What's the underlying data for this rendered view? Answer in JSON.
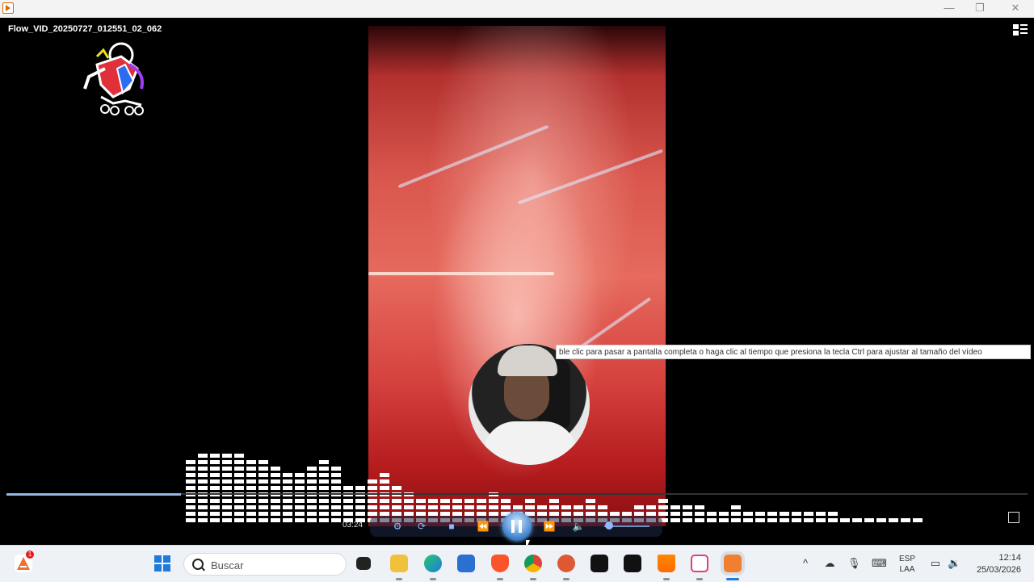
{
  "window": {
    "minimize_icon": "—",
    "restore_icon": "❐",
    "close_icon": "✕"
  },
  "player": {
    "file_title": "Flow_VID_20250727_012551_02_062",
    "time": "03:24",
    "tooltip": "ble clic para pasar a pantalla completa o haga clic al tiempo que presiona la tecla Ctrl para ajustar al tamaño del vídeo",
    "controls": [
      "settings",
      "repeat",
      "stop",
      "rewind",
      "pause",
      "fast-forward",
      "volume"
    ],
    "equalizer_levels": [
      9,
      10,
      10,
      10,
      10,
      9,
      9,
      8,
      7,
      7,
      8,
      9,
      8,
      5,
      5,
      6,
      7,
      5,
      4,
      3,
      3,
      3,
      3,
      3,
      3,
      4,
      3,
      2,
      3,
      2,
      3,
      2,
      2,
      3,
      2,
      1,
      1,
      2,
      2,
      3,
      2,
      2,
      2,
      1,
      1,
      2,
      1,
      1,
      1,
      1,
      1,
      1,
      1,
      1,
      0,
      0,
      0,
      0,
      0,
      0,
      0,
      0,
      0,
      0,
      0
    ]
  },
  "taskbar": {
    "search_placeholder": "Buscar",
    "notification_count": "1",
    "lang_top": "ESP",
    "lang_bottom": "LAA",
    "time": "12:14",
    "date": "25/03/2026",
    "apps": [
      "start",
      "search",
      "task-view",
      "file-explorer",
      "edge",
      "store",
      "brave",
      "chrome",
      "duckduckgo",
      "capcut",
      "media-player",
      "vlc",
      "snipping-tool",
      "active-player"
    ]
  }
}
